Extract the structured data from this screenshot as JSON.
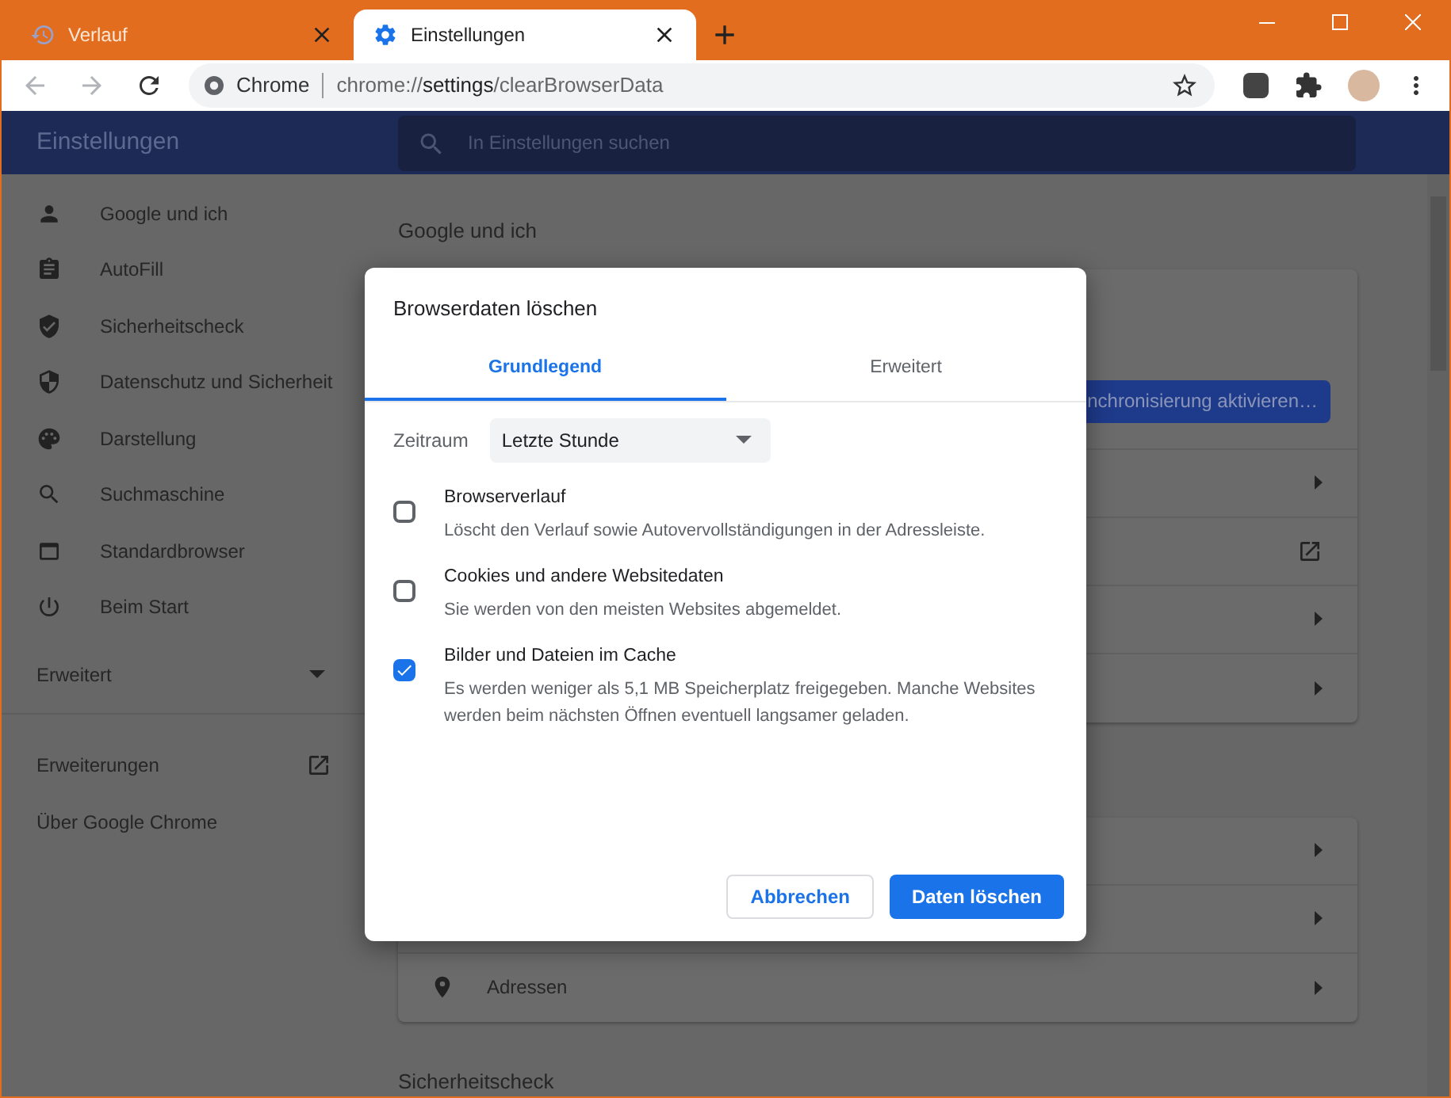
{
  "browser": {
    "tabs": [
      {
        "title": "Verlauf",
        "selected": false
      },
      {
        "title": "Einstellungen",
        "selected": true
      }
    ],
    "address": {
      "site_label": "Chrome",
      "url_scheme": "chrome://",
      "url_host": "settings",
      "url_path": "/clearBrowserData"
    }
  },
  "header": {
    "title": "Einstellungen",
    "search": {
      "placeholder": "In Einstellungen suchen"
    }
  },
  "sidebar": {
    "items": [
      {
        "label": "Google und ich"
      },
      {
        "label": "AutoFill"
      },
      {
        "label": "Sicherheitscheck"
      },
      {
        "label": "Datenschutz und Sicherheit"
      },
      {
        "label": "Darstellung"
      },
      {
        "label": "Suchmaschine"
      },
      {
        "label": "Standardbrowser"
      },
      {
        "label": "Beim Start"
      }
    ],
    "advanced": {
      "label": "Erweitert",
      "expanded": false
    },
    "links": [
      {
        "label": "Erweiterungen",
        "external": true
      },
      {
        "label": "Über Google Chrome",
        "external": false
      }
    ]
  },
  "main": {
    "section_title": "Google und ich",
    "sync_button": "nchronisierung aktivieren…",
    "card_rows": [
      {
        "kind": "arrow"
      },
      {
        "kind": "external"
      },
      {
        "kind": "arrow"
      },
      {
        "kind": "arrow"
      }
    ],
    "autofill_rows": [
      {
        "kind": "arrow"
      },
      {
        "kind": "arrow"
      },
      {
        "kind": "arrow",
        "label": "Adressen"
      }
    ],
    "next_section_title": "Sicherheitscheck"
  },
  "dialog": {
    "title": "Browserdaten löschen",
    "tabs": [
      {
        "label": "Grundlegend",
        "selected": true
      },
      {
        "label": "Erweitert",
        "selected": false
      }
    ],
    "time_range": {
      "label": "Zeitraum",
      "value": "Letzte Stunde"
    },
    "options": [
      {
        "title": "Browserverlauf",
        "description": "Löscht den Verlauf sowie Autovervollständigungen in der Adressleiste.",
        "checked": false
      },
      {
        "title": "Cookies und andere Websitedaten",
        "description": "Sie werden von den meisten Websites abgemeldet.",
        "checked": false
      },
      {
        "title": "Bilder und Dateien im Cache",
        "description": "Es werden weniger als 5,1 MB Speicherplatz freigegeben. Manche Websites werden beim nächsten Öffnen eventuell langsamer geladen.",
        "checked": true
      }
    ],
    "cancel_button": "Abbrechen",
    "confirm_button": "Daten löschen"
  }
}
